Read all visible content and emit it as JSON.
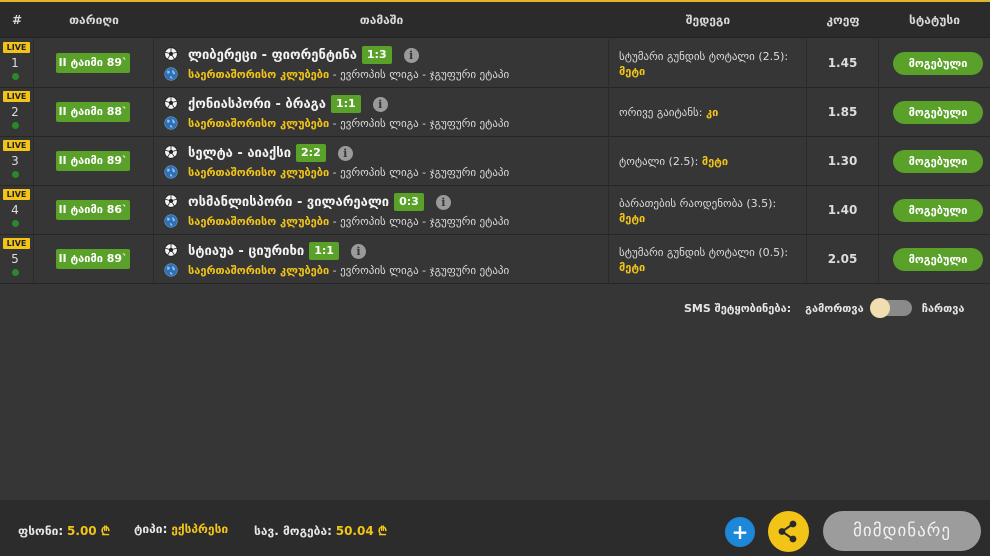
{
  "header": {
    "num": "#",
    "date": "თარიღი",
    "game": "თამაში",
    "bet": "შედეგი",
    "odd": "კოეფ",
    "status": "სტატუსი"
  },
  "rows": [
    {
      "live": "LIVE",
      "num": "1",
      "time": "II ტაიმი 89`",
      "teams": "ლიბერეცი - ფიორენტინა",
      "score": "1:3",
      "league_cat": "საერთაშორისო კლუბები",
      "league": " - ევროპის ლიგა - ჯგუფური ეტაპი",
      "bet": "სტუმარი გუნდის ტოტალი (2.5): ",
      "bet_pick": "მეტი",
      "odd": "1.45",
      "status": "მოგებული"
    },
    {
      "live": "LIVE",
      "num": "2",
      "time": "II ტაიმი 88`",
      "teams": "ქონიასპორი - ბრაგა",
      "score": "1:1",
      "league_cat": "საერთაშორისო კლუბები",
      "league": " - ევროპის ლიგა - ჯგუფური ეტაპი",
      "bet": "ორივე გაიტანს: ",
      "bet_pick": "კი",
      "odd": "1.85",
      "status": "მოგებული"
    },
    {
      "live": "LIVE",
      "num": "3",
      "time": "II ტაიმი 89`",
      "teams": "სელტა - აიაქსი",
      "score": "2:2",
      "league_cat": "საერთაშორისო კლუბები",
      "league": " - ევროპის ლიგა - ჯგუფური ეტაპი",
      "bet": "ტოტალი (2.5): ",
      "bet_pick": "მეტი",
      "odd": "1.30",
      "status": "მოგებული"
    },
    {
      "live": "LIVE",
      "num": "4",
      "time": "II ტაიმი 86`",
      "teams": "ოსმანლისპორი - ვილარეალი",
      "score": "0:3",
      "league_cat": "საერთაშორისო კლუბები",
      "league": " - ევროპის ლიგა - ჯგუფური ეტაპი",
      "bet": "ბარათების რაოდენობა (3.5): ",
      "bet_pick": "მეტი",
      "odd": "1.40",
      "status": "მოგებული"
    },
    {
      "live": "LIVE",
      "num": "5",
      "time": "II ტაიმი 89`",
      "teams": "სტიაუა - ციურიხი",
      "score": "1:1",
      "league_cat": "საერთაშორისო კლუბები",
      "league": " - ევროპის ლიგა - ჯგუფური ეტაპი",
      "bet": "სტუმარი გუნდის ტოტალი (0.5): ",
      "bet_pick": "მეტი",
      "odd": "2.05",
      "status": "მოგებული"
    }
  ],
  "sms": {
    "label": "SMS შეტყობინება:",
    "off": "გამორთვა",
    "on": "ჩართვა"
  },
  "footer": {
    "stake_label": "ფსონი:",
    "stake_value": "5.00 ₾",
    "type_label": "ტიპი:",
    "type_value": "ექსპრესი",
    "win_label": "სავ. მოგება:",
    "win_value": "50.04 ₾",
    "plus": "+",
    "current": "მიმდინარე"
  },
  "colors": {
    "accent": "#f2c418",
    "green": "#5aa12a",
    "blue": "#1e88d8",
    "background": "#363636"
  },
  "icons": [
    "soccer-ball-icon",
    "globe-icon",
    "info-icon",
    "share-icon",
    "plus-icon"
  ]
}
